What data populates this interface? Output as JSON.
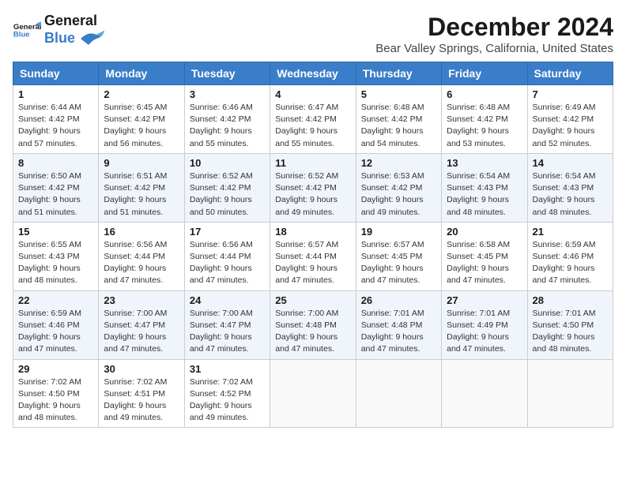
{
  "header": {
    "logo_general": "General",
    "logo_blue": "Blue",
    "title": "December 2024",
    "subtitle": "Bear Valley Springs, California, United States"
  },
  "weekdays": [
    "Sunday",
    "Monday",
    "Tuesday",
    "Wednesday",
    "Thursday",
    "Friday",
    "Saturday"
  ],
  "weeks": [
    [
      {
        "day": "1",
        "sunrise": "6:44 AM",
        "sunset": "4:42 PM",
        "daylight": "9 hours and 57 minutes."
      },
      {
        "day": "2",
        "sunrise": "6:45 AM",
        "sunset": "4:42 PM",
        "daylight": "9 hours and 56 minutes."
      },
      {
        "day": "3",
        "sunrise": "6:46 AM",
        "sunset": "4:42 PM",
        "daylight": "9 hours and 55 minutes."
      },
      {
        "day": "4",
        "sunrise": "6:47 AM",
        "sunset": "4:42 PM",
        "daylight": "9 hours and 55 minutes."
      },
      {
        "day": "5",
        "sunrise": "6:48 AM",
        "sunset": "4:42 PM",
        "daylight": "9 hours and 54 minutes."
      },
      {
        "day": "6",
        "sunrise": "6:48 AM",
        "sunset": "4:42 PM",
        "daylight": "9 hours and 53 minutes."
      },
      {
        "day": "7",
        "sunrise": "6:49 AM",
        "sunset": "4:42 PM",
        "daylight": "9 hours and 52 minutes."
      }
    ],
    [
      {
        "day": "8",
        "sunrise": "6:50 AM",
        "sunset": "4:42 PM",
        "daylight": "9 hours and 51 minutes."
      },
      {
        "day": "9",
        "sunrise": "6:51 AM",
        "sunset": "4:42 PM",
        "daylight": "9 hours and 51 minutes."
      },
      {
        "day": "10",
        "sunrise": "6:52 AM",
        "sunset": "4:42 PM",
        "daylight": "9 hours and 50 minutes."
      },
      {
        "day": "11",
        "sunrise": "6:52 AM",
        "sunset": "4:42 PM",
        "daylight": "9 hours and 49 minutes."
      },
      {
        "day": "12",
        "sunrise": "6:53 AM",
        "sunset": "4:42 PM",
        "daylight": "9 hours and 49 minutes."
      },
      {
        "day": "13",
        "sunrise": "6:54 AM",
        "sunset": "4:43 PM",
        "daylight": "9 hours and 48 minutes."
      },
      {
        "day": "14",
        "sunrise": "6:54 AM",
        "sunset": "4:43 PM",
        "daylight": "9 hours and 48 minutes."
      }
    ],
    [
      {
        "day": "15",
        "sunrise": "6:55 AM",
        "sunset": "4:43 PM",
        "daylight": "9 hours and 48 minutes."
      },
      {
        "day": "16",
        "sunrise": "6:56 AM",
        "sunset": "4:44 PM",
        "daylight": "9 hours and 47 minutes."
      },
      {
        "day": "17",
        "sunrise": "6:56 AM",
        "sunset": "4:44 PM",
        "daylight": "9 hours and 47 minutes."
      },
      {
        "day": "18",
        "sunrise": "6:57 AM",
        "sunset": "4:44 PM",
        "daylight": "9 hours and 47 minutes."
      },
      {
        "day": "19",
        "sunrise": "6:57 AM",
        "sunset": "4:45 PM",
        "daylight": "9 hours and 47 minutes."
      },
      {
        "day": "20",
        "sunrise": "6:58 AM",
        "sunset": "4:45 PM",
        "daylight": "9 hours and 47 minutes."
      },
      {
        "day": "21",
        "sunrise": "6:59 AM",
        "sunset": "4:46 PM",
        "daylight": "9 hours and 47 minutes."
      }
    ],
    [
      {
        "day": "22",
        "sunrise": "6:59 AM",
        "sunset": "4:46 PM",
        "daylight": "9 hours and 47 minutes."
      },
      {
        "day": "23",
        "sunrise": "7:00 AM",
        "sunset": "4:47 PM",
        "daylight": "9 hours and 47 minutes."
      },
      {
        "day": "24",
        "sunrise": "7:00 AM",
        "sunset": "4:47 PM",
        "daylight": "9 hours and 47 minutes."
      },
      {
        "day": "25",
        "sunrise": "7:00 AM",
        "sunset": "4:48 PM",
        "daylight": "9 hours and 47 minutes."
      },
      {
        "day": "26",
        "sunrise": "7:01 AM",
        "sunset": "4:48 PM",
        "daylight": "9 hours and 47 minutes."
      },
      {
        "day": "27",
        "sunrise": "7:01 AM",
        "sunset": "4:49 PM",
        "daylight": "9 hours and 47 minutes."
      },
      {
        "day": "28",
        "sunrise": "7:01 AM",
        "sunset": "4:50 PM",
        "daylight": "9 hours and 48 minutes."
      }
    ],
    [
      {
        "day": "29",
        "sunrise": "7:02 AM",
        "sunset": "4:50 PM",
        "daylight": "9 hours and 48 minutes."
      },
      {
        "day": "30",
        "sunrise": "7:02 AM",
        "sunset": "4:51 PM",
        "daylight": "9 hours and 49 minutes."
      },
      {
        "day": "31",
        "sunrise": "7:02 AM",
        "sunset": "4:52 PM",
        "daylight": "9 hours and 49 minutes."
      },
      null,
      null,
      null,
      null
    ]
  ],
  "labels": {
    "sunrise": "Sunrise:",
    "sunset": "Sunset:",
    "daylight": "Daylight:"
  }
}
